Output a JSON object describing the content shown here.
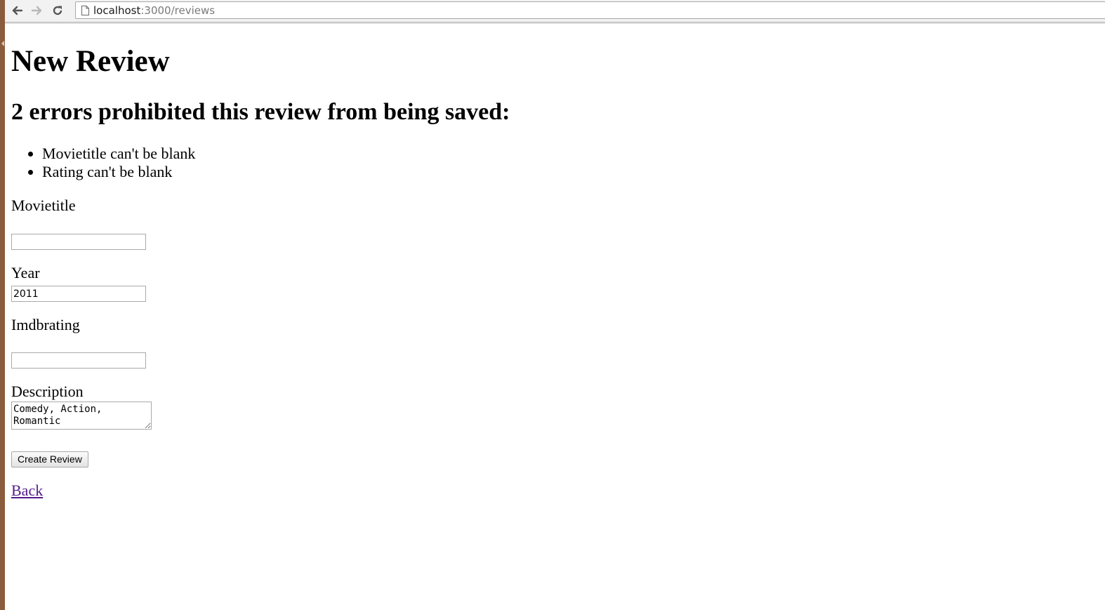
{
  "browser": {
    "url_host": "localhost",
    "url_rest": ":3000/reviews",
    "back_icon": "arrow-left-icon",
    "forward_icon": "arrow-right-icon",
    "reload_icon": "reload-icon",
    "page_icon": "page-icon"
  },
  "page": {
    "title": "New Review",
    "error_heading": "2 errors prohibited this review from being saved:",
    "errors": [
      "Movietitle can't be blank",
      "Rating can't be blank"
    ]
  },
  "form": {
    "movietitle": {
      "label": "Movietitle",
      "value": ""
    },
    "year": {
      "label": "Year",
      "value": "2011"
    },
    "imdbrating": {
      "label": "Imdbrating",
      "value": ""
    },
    "description": {
      "label": "Description",
      "value": "Comedy, Action,\nRomantic"
    },
    "submit_label": "Create Review"
  },
  "links": {
    "back": "Back"
  },
  "colors": {
    "visited_link": "#551a8b",
    "window_edge": "#8a5c3c"
  }
}
